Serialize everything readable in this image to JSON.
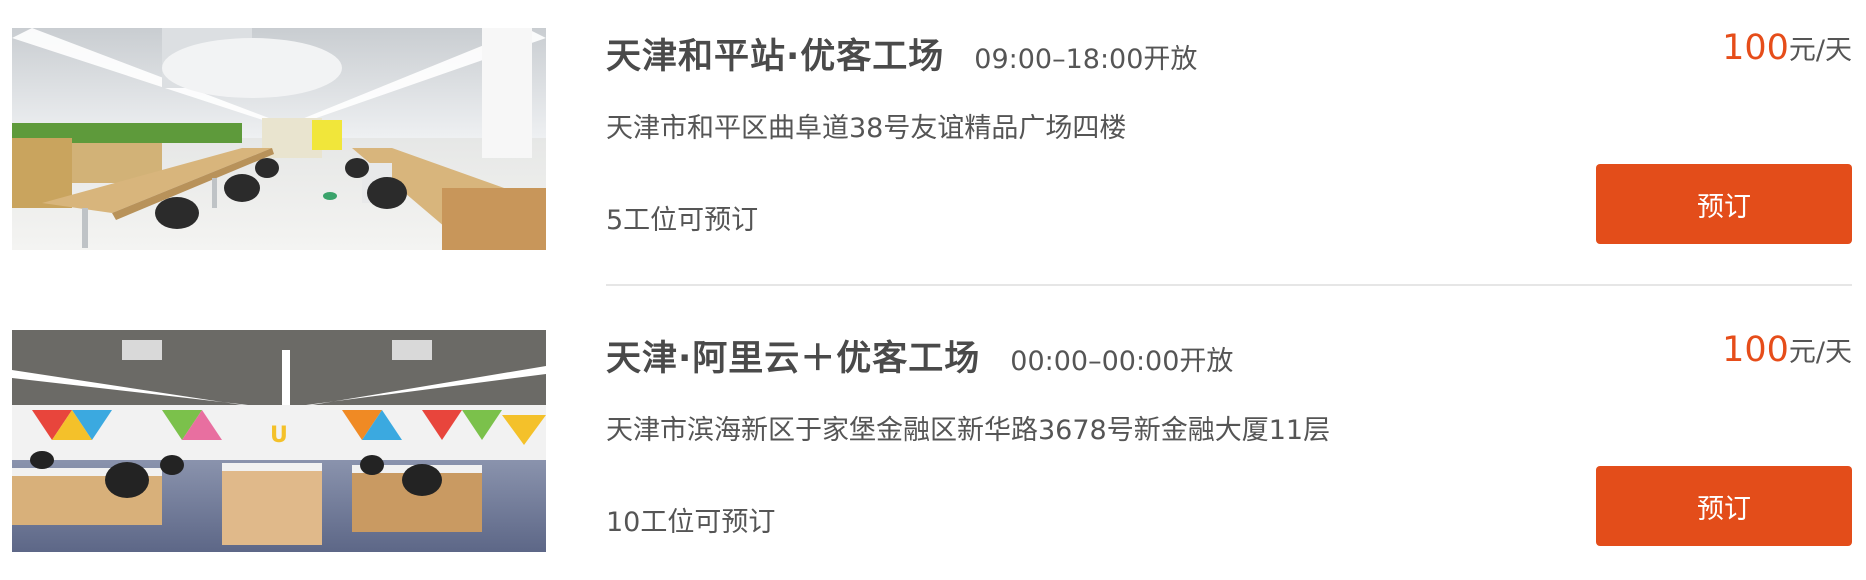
{
  "spaces": [
    {
      "name": "天津和平站·优客工场",
      "hours": "09:00–18:00开放",
      "address": "天津市和平区曲阜道38号友谊精品广场四楼",
      "seats": "5工位可预订",
      "price_value": "100",
      "price_unit": "元/天",
      "book_label": "预订",
      "photo": "office-photo"
    },
    {
      "name": "天津·阿里云＋优客工场",
      "hours": "00:00–00:00开放",
      "address": "天津市滨海新区于家堡金融区新华路3678号新金融大厦11层",
      "seats": "10工位可预订",
      "price_value": "100",
      "price_unit": "元/天",
      "book_label": "预订",
      "photo": "office-photo"
    }
  ],
  "colors": {
    "accent": "#e34d1a",
    "price": "#e64d1a",
    "text": "#555555",
    "title": "#4a4a4a",
    "divider": "#e6e6e6"
  }
}
